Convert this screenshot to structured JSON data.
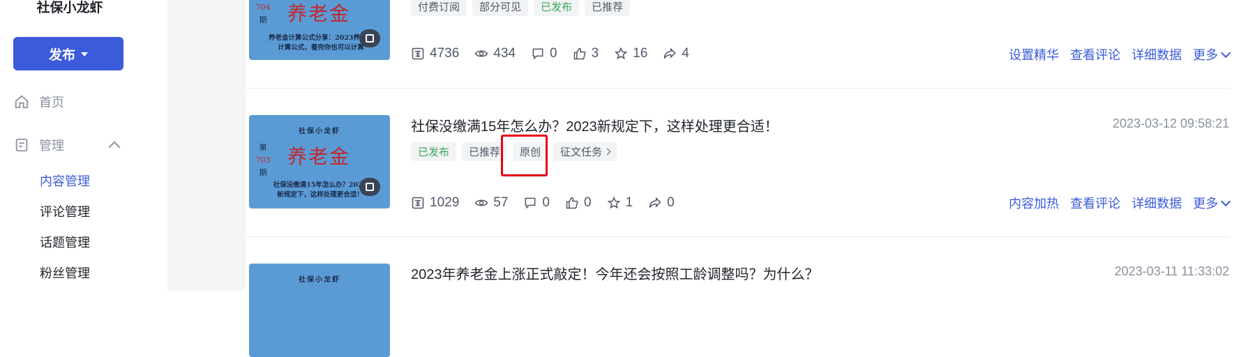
{
  "sidebar": {
    "brand": "社保小龙虾",
    "publish_label": "发布",
    "nav": {
      "home": "首页",
      "manage": "管理"
    },
    "sub_items": [
      "内容管理",
      "评论管理",
      "话题管理",
      "粉丝管理"
    ]
  },
  "articles": [
    {
      "title": "",
      "date": "",
      "tags": [
        "付费订阅",
        "部分可见",
        "已发布",
        "已推荐"
      ],
      "thumb": {
        "top": "",
        "issue_prefix": "",
        "issue_num": "704",
        "issue_suffix": "期",
        "big": "养老金",
        "desc": "养老金计算公式分享：2023养老金计算公式，看完你也可以计算"
      },
      "stats": {
        "reads": "4736",
        "views": "434",
        "comments": "0",
        "likes": "3",
        "favorites": "16",
        "shares": "4"
      },
      "actions": [
        "设置精华",
        "查看评论",
        "详细数据",
        "更多"
      ]
    },
    {
      "title": "社保没缴满15年怎么办？2023新规定下，这样处理更合适！",
      "date": "2023-03-12 09:58:21",
      "tags": [
        "已发布",
        "已推荐",
        "原创",
        "征文任务"
      ],
      "thumb": {
        "top": "社保小龙虾",
        "issue_prefix": "第",
        "issue_num": "703",
        "issue_suffix": "期",
        "big": "养老金",
        "desc": "社保没缴满15年怎么办？2023新规定下，这样处理更合适！"
      },
      "stats": {
        "reads": "1029",
        "views": "57",
        "comments": "0",
        "likes": "0",
        "favorites": "1",
        "shares": "0"
      },
      "actions": [
        "内容加热",
        "查看评论",
        "详细数据",
        "更多"
      ]
    },
    {
      "title": "2023年养老金上涨正式敲定！今年还会按照工龄调整吗？为什么？",
      "date": "2023-03-11 11:33:02",
      "thumb": {
        "top": "社保小龙虾"
      }
    }
  ],
  "colors": {
    "accent": "#3b5bdb",
    "published": "#3ca55c",
    "highlight": "#e60012"
  }
}
